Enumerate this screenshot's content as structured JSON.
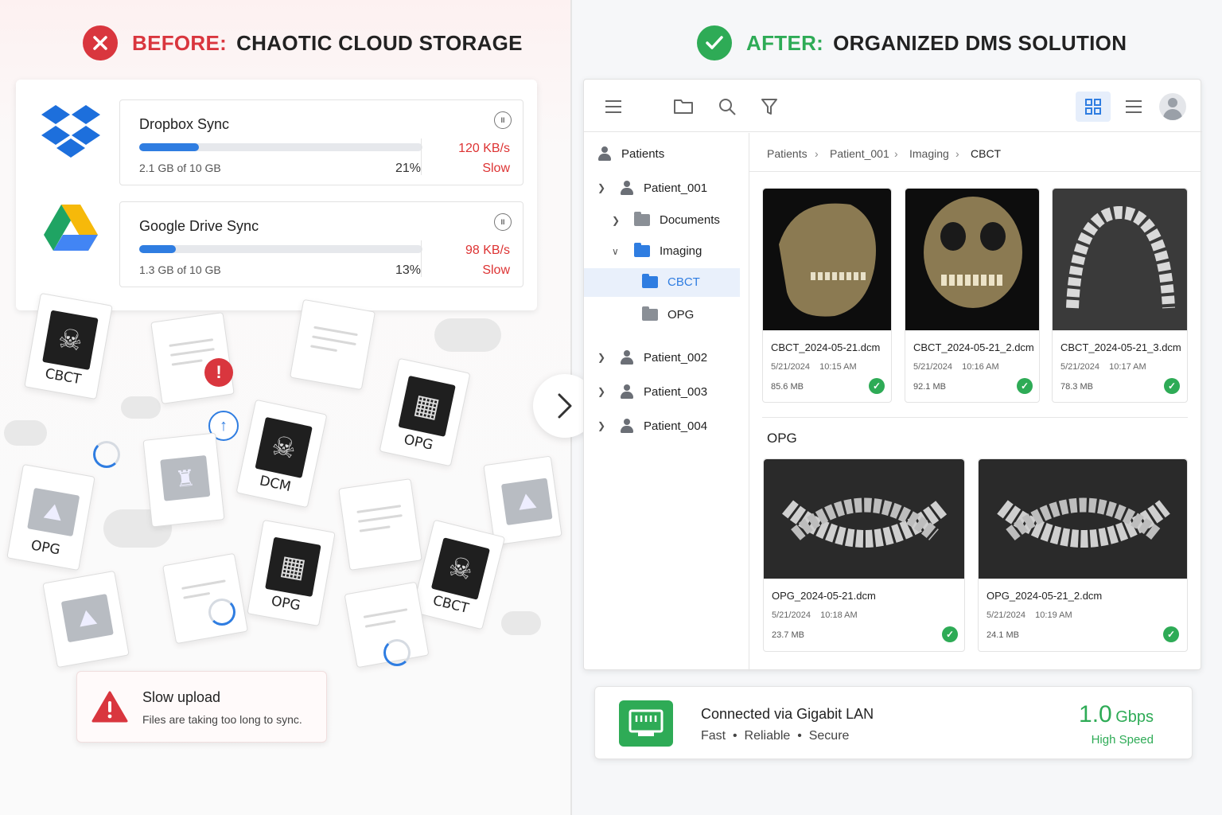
{
  "before": {
    "tag": "BEFORE:",
    "title": "CHAOTIC CLOUD STORAGE",
    "sync": [
      {
        "name": "Dropbox Sync",
        "size": "2.1 GB of 10 GB",
        "percent_label": "21%",
        "progress": 0.21,
        "rate": "120 KB/s",
        "status": "Slow"
      },
      {
        "name": "Google Drive Sync",
        "size": "1.3 GB of 10 GB",
        "percent_label": "13%",
        "progress": 0.13,
        "rate": "98 KB/s",
        "status": "Slow"
      }
    ],
    "files": [
      "CBCT",
      "DCM",
      "OPG",
      "OPG",
      "OPG",
      "CBCT"
    ],
    "alert": {
      "title": "Slow upload",
      "message": "Files are taking too long to sync."
    }
  },
  "after": {
    "tag": "AFTER:",
    "title": "ORGANIZED DMS SOLUTION",
    "tree": {
      "root": "Patients",
      "patient_001": "Patient_001",
      "documents": "Documents",
      "imaging": "Imaging",
      "cbct": "CBCT",
      "opg": "OPG",
      "patient_002": "Patient_002",
      "patient_003": "Patient_003",
      "patient_004": "Patient_004"
    },
    "breadcrumb": [
      "Patients",
      "Patient_001",
      "Imaging",
      "CBCT"
    ],
    "cbct_files": [
      {
        "name": "CBCT_2024-05-21.dcm",
        "date": "5/21/2024",
        "time": "10:15 AM",
        "size": "85.6 MB"
      },
      {
        "name": "CBCT_2024-05-21_2.dcm",
        "date": "5/21/2024",
        "time": "10:16 AM",
        "size": "92.1 MB"
      },
      {
        "name": "CBCT_2024-05-21_3.dcm",
        "date": "5/21/2024",
        "time": "10:17 AM",
        "size": "78.3 MB"
      }
    ],
    "opg_section": "OPG",
    "opg_files": [
      {
        "name": "OPG_2024-05-21.dcm",
        "date": "5/21/2024",
        "time": "10:18 AM",
        "size": "23.7 MB"
      },
      {
        "name": "OPG_2024-05-21_2.dcm",
        "date": "5/21/2024",
        "time": "10:19 AM",
        "size": "24.1 MB"
      }
    ],
    "connection": {
      "title": "Connected via Gigabit LAN",
      "features": [
        "Fast",
        "Reliable",
        "Secure"
      ],
      "speed_value": "1.0",
      "speed_unit": "Gbps",
      "speed_label": "High Speed"
    }
  },
  "colors": {
    "bad": "#d9363e",
    "good": "#2eab56",
    "accent": "#2f7de1",
    "folder_blue": "#2f7de1",
    "folder_gray": "#8a8f96"
  }
}
